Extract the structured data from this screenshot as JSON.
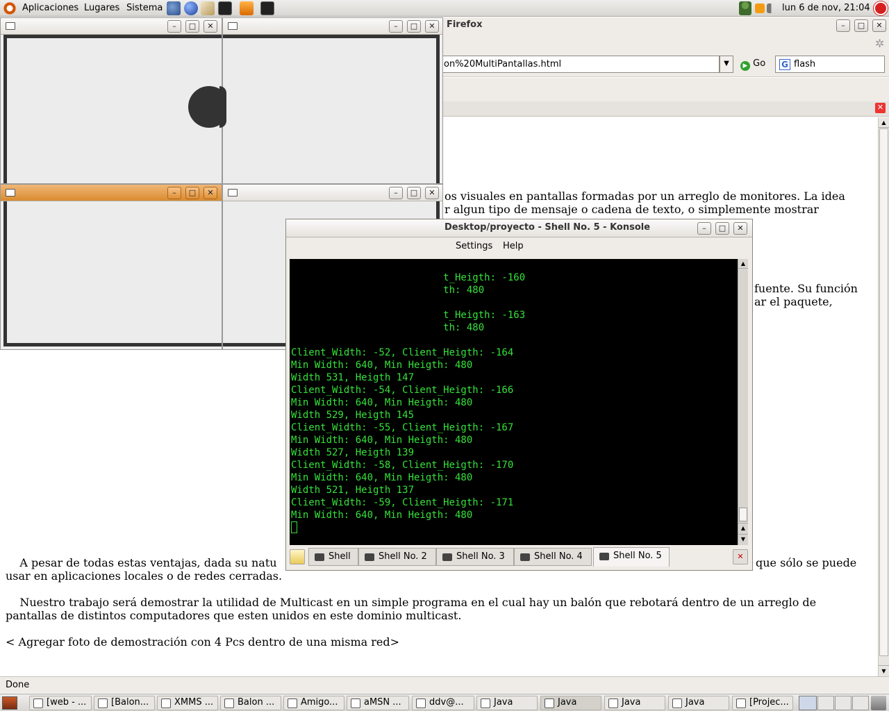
{
  "top_panel": {
    "menus": [
      "Aplicaciones",
      "Lugares",
      "Sistema"
    ],
    "clock": "lun  6 de nov, 21:04"
  },
  "firefox": {
    "title": "as - Firefox",
    "url": "on%20MultiPantallas.html",
    "go_label": "Go",
    "search_value": "flash",
    "status": "Done",
    "content": {
      "p1_line1": "os visuales en pantallas formadas por un arreglo de monitores. La idea",
      "p1_line2": "r algun tipo de mensaje o cadena de texto, o simplemente mostrar",
      "p2_line1": "fuente. Su función",
      "p2_line2": "ar el paquete,",
      "p3_line1_left": "    A pesar de todas estas ventajas, dada su natu",
      "p3_line1_right": "que sólo se puede",
      "p3_line2": "usar en aplicaciones locales o de redes cerradas.",
      "p4_line1": "    Nuestro trabajo será demostrar la utilidad de Multicast en un simple programa en el cual hay un balón que rebotará dentro de un arreglo de",
      "p4_line2": "pantallas de distintos computadores que esten unidos en este dominio multicast.",
      "p5": "< Agregar foto de demostración con 4 Pcs dentro de una misma red>"
    }
  },
  "konsole": {
    "title": "Desktop/proyecto - Shell No. 5 - Konsole",
    "menus": [
      "Settings",
      "Help"
    ],
    "terminal_lines": [
      "                          t_Heigth: -160",
      "                          th: 480",
      "",
      "                          t_Heigth: -163",
      "                          th: 480",
      "",
      "Client_Width: -52, Client_Heigth: -164",
      "Min Width: 640, Min Heigth: 480",
      "Width 531, Heigth 147",
      "Client_Width: -54, Client_Heigth: -166",
      "Min Width: 640, Min Heigth: 480",
      "Width 529, Heigth 145",
      "Client_Width: -55, Client_Heigth: -167",
      "Min Width: 640, Min Heigth: 480",
      "Width 527, Heigth 139",
      "Client_Width: -58, Client_Heigth: -170",
      "Min Width: 640, Min Heigth: 480",
      "Width 521, Heigth 137",
      "Client_Width: -59, Client_Heigth: -171",
      "Min Width: 640, Min Heigth: 480"
    ],
    "tabs": [
      "Shell",
      "Shell No. 2",
      "Shell No. 3",
      "Shell No. 4",
      "Shell No. 5"
    ]
  },
  "taskbar": {
    "items": [
      "[web - ...",
      "[Balon...",
      "XMMS ...",
      "Balon ...",
      "Amigo...",
      "aMSN ...",
      "ddv@...",
      "Java",
      "Java",
      "Java",
      "Java",
      "[Projec..."
    ]
  },
  "colors": {
    "terminal_text": "#35e23a",
    "active_titlebar": "#e19a4a",
    "ball": "#333333"
  }
}
